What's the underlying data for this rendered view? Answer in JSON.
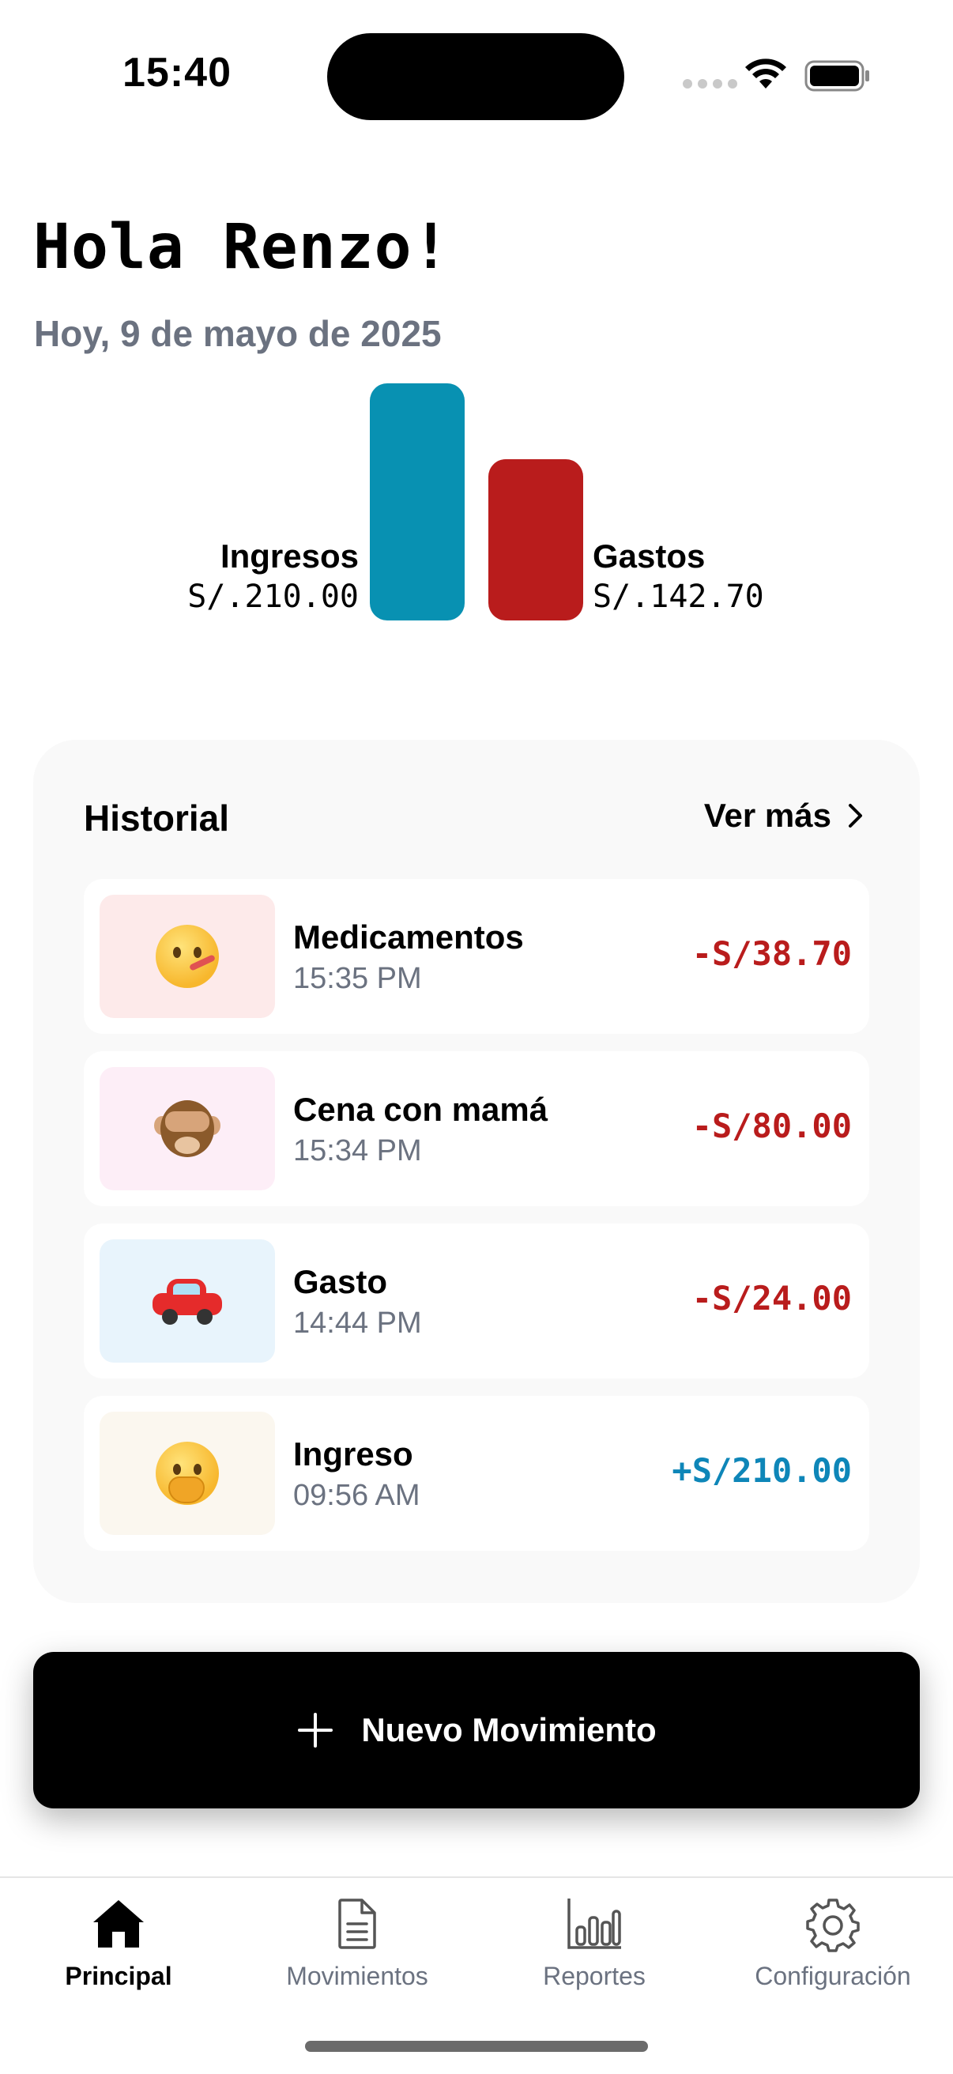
{
  "status_bar": {
    "time": "15:40"
  },
  "header": {
    "greeting": "Hola Renzo!",
    "date": "Hoy, 9 de mayo de 2025"
  },
  "summary": {
    "income_label": "Ingresos",
    "income_amount": "S/.210.00",
    "expense_label": "Gastos",
    "expense_amount": "S/.142.70",
    "income_value": 210.0,
    "expense_value": 142.7,
    "colors": {
      "income": "#0891b2",
      "expense": "#b91c1c"
    }
  },
  "history": {
    "title": "Historial",
    "see_more": "Ver más",
    "items": [
      {
        "title": "Medicamentos",
        "time": "15:35 PM",
        "amount": "-S/38.70",
        "icon": "thermometer-face-emoji",
        "type": "expense",
        "bg": "#fdeaea"
      },
      {
        "title": "Cena con mamá",
        "time": "15:34 PM",
        "amount": "-S/80.00",
        "icon": "see-no-evil-monkey-emoji",
        "type": "expense",
        "bg": "#fdeef7"
      },
      {
        "title": "Gasto",
        "time": "14:44 PM",
        "amount": "-S/24.00",
        "icon": "red-car-emoji",
        "type": "expense",
        "bg": "#e8f4fc"
      },
      {
        "title": "Ingreso",
        "time": "09:56 AM",
        "amount": "+S/210.00",
        "icon": "hand-over-mouth-face-emoji",
        "type": "income",
        "bg": "#fbf7ef"
      }
    ]
  },
  "action": {
    "label": "Nuevo Movimiento"
  },
  "tabbar": {
    "items": [
      {
        "label": "Principal",
        "icon": "home-icon",
        "active": true
      },
      {
        "label": "Movimientos",
        "icon": "document-icon",
        "active": false
      },
      {
        "label": "Reportes",
        "icon": "bar-chart-icon",
        "active": false
      },
      {
        "label": "Configuración",
        "icon": "gear-icon",
        "active": false
      }
    ]
  }
}
